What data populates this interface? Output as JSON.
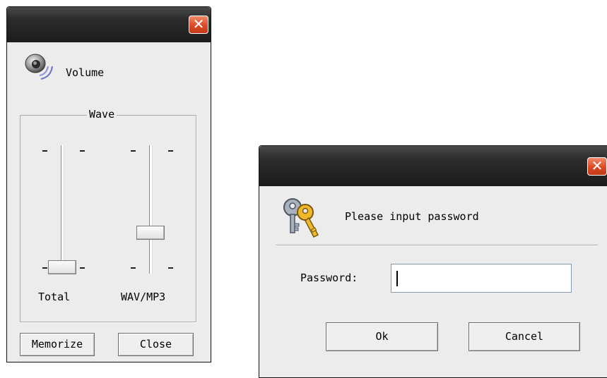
{
  "volume_dialog": {
    "title": "Volume",
    "group_label": "Wave",
    "sliders": [
      {
        "label": "Total",
        "level": 0.05
      },
      {
        "label": "WAV/MP3",
        "level": 0.32
      }
    ],
    "memorize_label": "Memorize",
    "close_label": "Close"
  },
  "password_dialog": {
    "prompt": "Please input password",
    "field_label": "Password:",
    "field_value": "",
    "ok_label": "Ok",
    "cancel_label": "Cancel"
  },
  "icons": {
    "close": "close-icon",
    "speaker": "speaker-icon",
    "keys": "keys-icon"
  },
  "colors": {
    "titlebar": "#2b2b2b",
    "close_button": "#dc4a25",
    "window_bg": "#ececec"
  }
}
